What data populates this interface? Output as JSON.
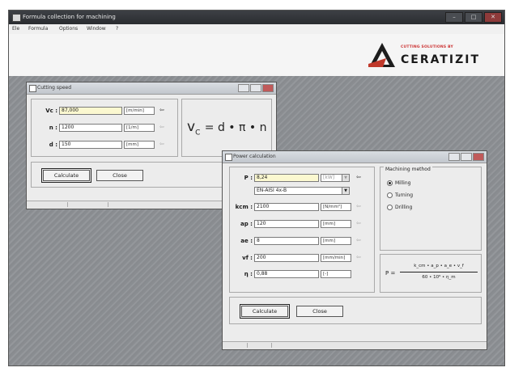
{
  "window": {
    "title": "Formula collection for machining"
  },
  "menu": [
    "Ele",
    "Formula",
    "Options",
    "Window",
    "?"
  ],
  "logo": {
    "tagline": "CUTTING SOLUTIONS BY",
    "wordmark": "CERATIZIT",
    "accent_color": "#c0392b"
  },
  "cutting_speed": {
    "title": "Cutting speed",
    "rows": [
      {
        "label": "Vc :",
        "value": "87,000",
        "unit": "[m/min]"
      },
      {
        "label": "n :",
        "value": "1200",
        "unit": "[1/m]"
      },
      {
        "label": "d :",
        "value": "150",
        "unit": "[mm]"
      }
    ],
    "formula": {
      "lhs": "v",
      "sub": "C",
      "rhs": "= d • π • n"
    },
    "buttons": {
      "calculate": "Calculate",
      "close": "Close"
    }
  },
  "power": {
    "title": "Power calculation",
    "p_label": "P :",
    "p_value": "8,24",
    "p_unit": "[kW]",
    "material": "EN-AISI 4x-B",
    "rows": [
      {
        "label": "kcm :",
        "value": "2100",
        "unit": "[N/mm²]"
      },
      {
        "label": "ap :",
        "value": "120",
        "unit": "[mm]"
      },
      {
        "label": "ae :",
        "value": "8",
        "unit": "[mm]"
      },
      {
        "label": "vf :",
        "value": "200",
        "unit": "[mm/min]"
      },
      {
        "label": "η :",
        "value": "0,88",
        "unit": "[-]"
      }
    ],
    "machining_method_label": "Machining method",
    "methods": [
      {
        "label": "Milling",
        "selected": true
      },
      {
        "label": "Turning",
        "selected": false
      },
      {
        "label": "Drilling",
        "selected": false
      }
    ],
    "formula": {
      "lhs": "P =",
      "num": "k_cm • a_p • a_e • v_f",
      "den": "60 • 10⁶ • η_m"
    },
    "buttons": {
      "calculate": "Calculate",
      "close": "Close"
    }
  }
}
